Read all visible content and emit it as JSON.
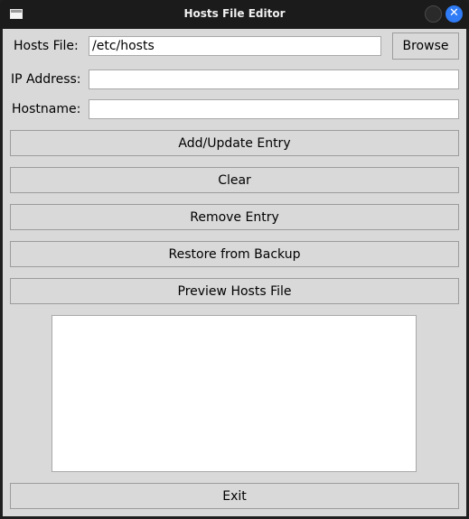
{
  "window": {
    "title": "Hosts File Editor",
    "app_icon": "window-icon",
    "minimize_icon": "minimize-icon",
    "close_icon": "close-icon",
    "accent_color": "#2f7cf6"
  },
  "form": {
    "hosts_file_label": "Hosts File:",
    "hosts_file_value": "/etc/hosts",
    "browse_label": "Browse",
    "ip_label": "IP Address:",
    "ip_value": "",
    "hostname_label": "Hostname:",
    "hostname_value": ""
  },
  "actions": {
    "add_update_label": "Add/Update Entry",
    "clear_label": "Clear",
    "remove_label": "Remove Entry",
    "restore_label": "Restore from Backup",
    "preview_label": "Preview Hosts File",
    "exit_label": "Exit"
  },
  "preview": {
    "content": ""
  }
}
